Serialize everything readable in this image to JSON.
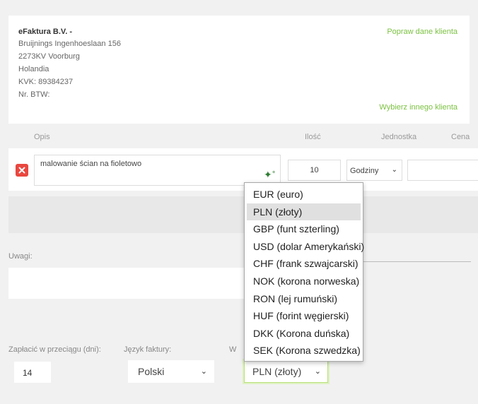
{
  "client": {
    "name": "eFaktura B.V. -",
    "address_lines": [
      "Bruijnings Ingenhoeslaan 156",
      "2273KV Voorburg",
      "Holandia",
      "KVK: 89384237",
      "Nr. BTW:"
    ],
    "edit_link": "Popraw dane klienta",
    "choose_link": "Wybierz innego klienta"
  },
  "columns": {
    "description": "Opis",
    "quantity": "Ilość",
    "unit": "Jednostka",
    "price": "Cena"
  },
  "item": {
    "description": "malowanie ścian na fioletowo",
    "quantity": "10",
    "unit": "Godziny"
  },
  "notes": {
    "label": "Uwagi:"
  },
  "footer": {
    "days_label": "Zapłacić w przeciągu (dni):",
    "days_value": "14",
    "language_label": "Język faktury:",
    "language_value": "Polski",
    "currency_label_partial": "W",
    "currency_value": "PLN (złoty)"
  },
  "currency_options": [
    "EUR (euro)",
    "PLN (złoty)",
    "GBP (funt szterling)",
    "USD (dolar Amerykański)",
    "CHF (frank szwajcarski)",
    "NOK (korona norweska)",
    "RON (lej rumuński)",
    "HUF (forint węgierski)",
    "DKK (Korona duńska)",
    "SEK (Korona szwedzka)"
  ],
  "selected_currency_index": 1,
  "colors": {
    "accent_green": "#7cc242",
    "delete_red": "#e9473f"
  }
}
